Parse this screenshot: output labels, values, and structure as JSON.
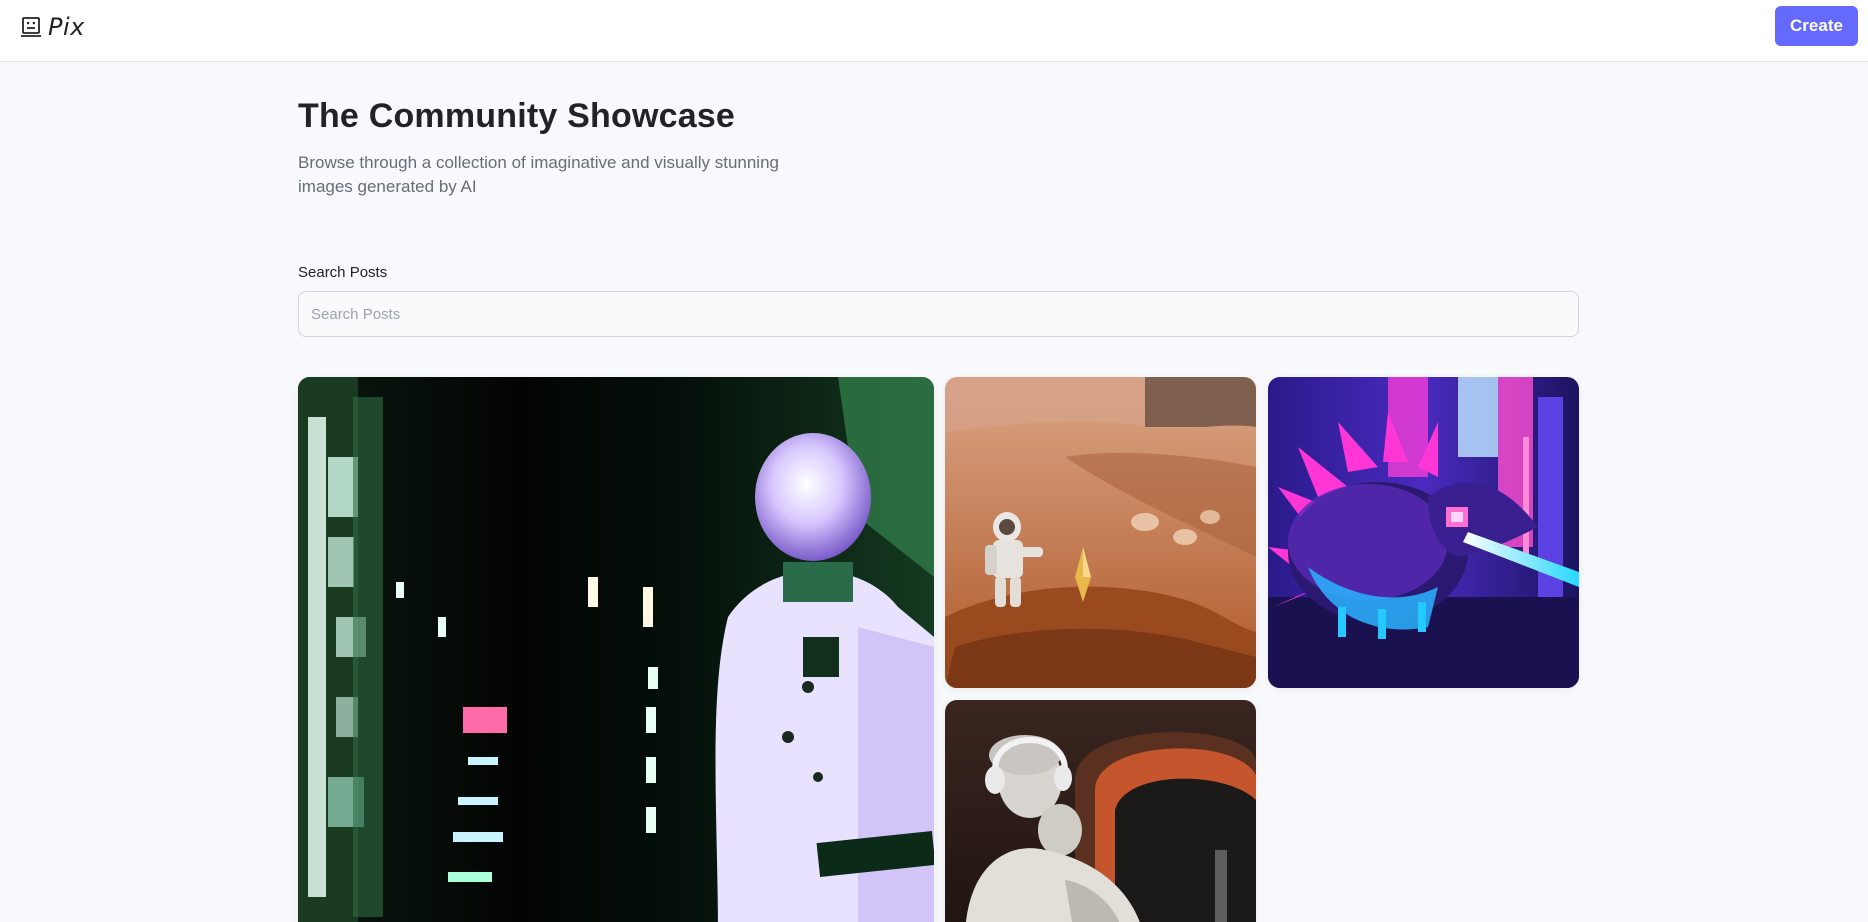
{
  "header": {
    "logo_text": "Pix",
    "logo_icon": "robot-face-icon",
    "create_label": "Create"
  },
  "hero": {
    "title": "The Community Showcase",
    "subtitle": "Browse through a collection of imaginative and visually stunning images generated by AI"
  },
  "search": {
    "label": "Search Posts",
    "placeholder": "Search Posts",
    "value": ""
  },
  "gallery": {
    "posts": [
      {
        "name": "robot-in-neon-city"
      },
      {
        "name": "astronaut-on-mars"
      },
      {
        "name": "neon-hedgehog"
      },
      {
        "name": "statue-with-headphones"
      }
    ]
  },
  "colors": {
    "accent": "#6469ff",
    "background": "#f8f9fc",
    "title_text": "#222328",
    "subtitle_text": "#666e75"
  }
}
